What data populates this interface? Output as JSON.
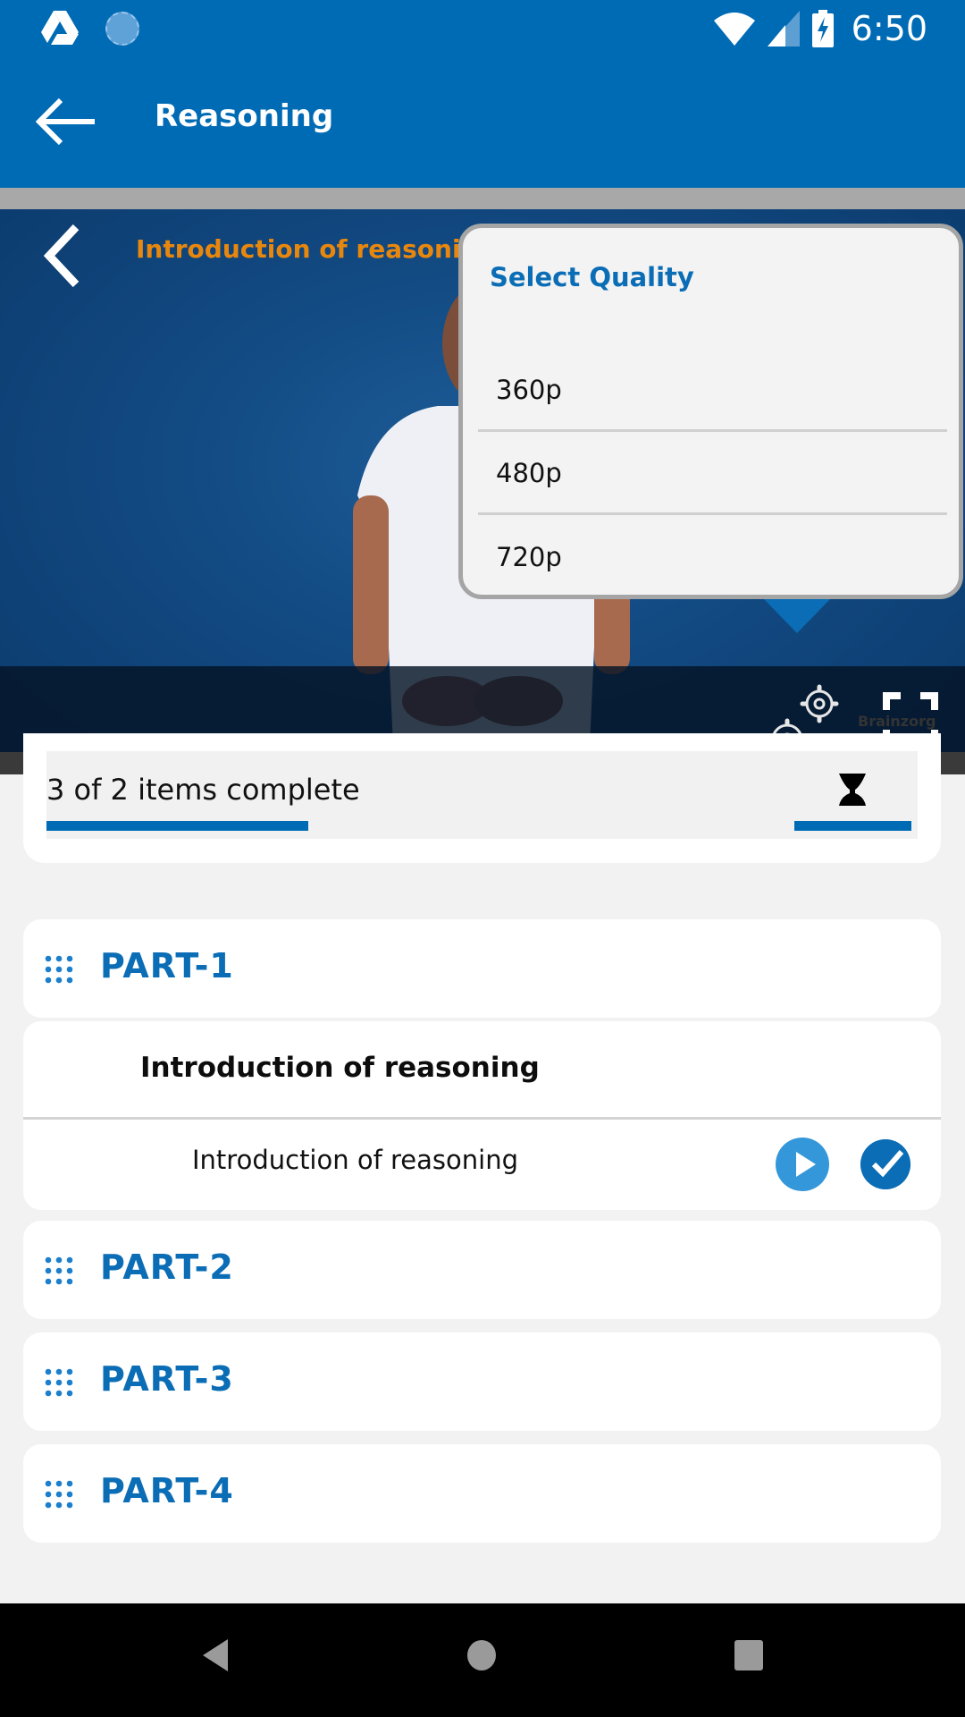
{
  "status_bar": {
    "time": "6:50",
    "left_icons": [
      "drive-icon",
      "sync-icon"
    ],
    "right_icons": [
      "wifi-icon",
      "signal-icon",
      "battery-charging-icon"
    ]
  },
  "app_bar": {
    "title": "Reasoning",
    "back_icon": "arrow-left-icon"
  },
  "video_player": {
    "title": "Introduction of reasoning",
    "back_icon": "chevron-left-icon",
    "watermark": "Brainzorg",
    "settings_icon": "gears-icon",
    "fullscreen_icon": "fullscreen-icon"
  },
  "quality_menu": {
    "title": "Select Quality",
    "options": [
      "360p",
      "480p",
      "720p"
    ]
  },
  "progress": {
    "text": "3 of 2  items complete",
    "fraction": 0.3,
    "color": "#006bb5"
  },
  "course": {
    "parts": [
      {
        "label": "PART-1"
      },
      {
        "label": "PART-2"
      },
      {
        "label": "PART-3"
      },
      {
        "label": "PART-4"
      }
    ],
    "section_title": "Introduction of reasoning",
    "lessons": [
      {
        "title": "Introduction of reasoning",
        "completed": true
      }
    ]
  },
  "colors": {
    "primary": "#006bb5",
    "accent_orange": "#e8870d",
    "play_blue": "#3497d9"
  },
  "nav_bar": {
    "buttons": [
      "back",
      "home",
      "recents"
    ]
  }
}
